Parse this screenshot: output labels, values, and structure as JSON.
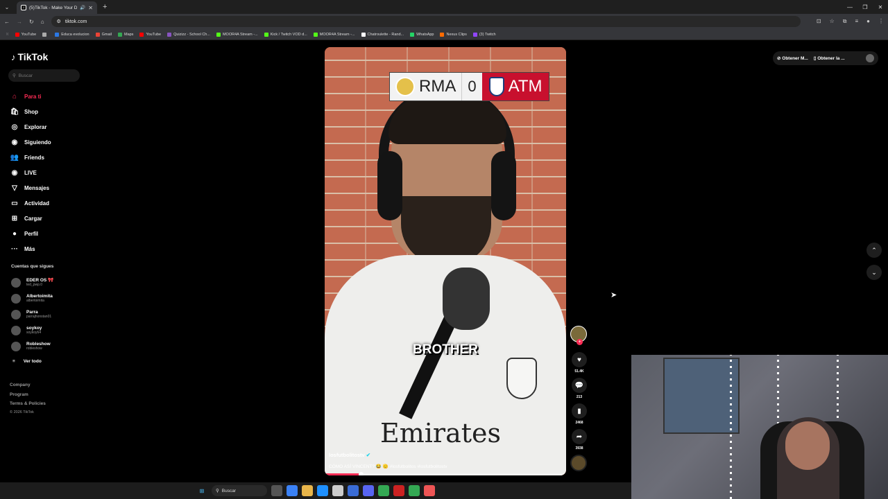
{
  "browser": {
    "tab_title": "(5)TikTok - Make Your Day",
    "url": "tiktok.com",
    "bookmarks": [
      {
        "label": "YouTube",
        "color": "#ff0000"
      },
      {
        "label": "",
        "color": "#aaaaaa"
      },
      {
        "label": "Educa evolucion",
        "color": "#2b78e4"
      },
      {
        "label": "Gmail",
        "color": "#ea4335"
      },
      {
        "label": "Maps",
        "color": "#34a853"
      },
      {
        "label": "YouTube",
        "color": "#ff0000"
      },
      {
        "label": "Quizizz - School Ch...",
        "color": "#8854c0"
      },
      {
        "label": "MOOR4A Stream -...",
        "color": "#53fc18"
      },
      {
        "label": "Kick / Twitch VOD d...",
        "color": "#53fc18"
      },
      {
        "label": "MOOR4A Stream -...",
        "color": "#53fc18"
      },
      {
        "label": "Chatroulette - Rand...",
        "color": "#ffffff"
      },
      {
        "label": "WhatsApp",
        "color": "#25d366"
      },
      {
        "label": "Nexus Clips",
        "color": "#ff6b00"
      },
      {
        "label": "(3) Twitch",
        "color": "#9146ff"
      }
    ]
  },
  "tiktok": {
    "logo": "TikTok",
    "search_placeholder": "Buscar",
    "nav": [
      {
        "label": "Para ti",
        "icon": "home-icon",
        "glyph": "⌂",
        "active": true
      },
      {
        "label": "Shop",
        "icon": "shop-icon",
        "glyph": "🛍",
        "active": false
      },
      {
        "label": "Explorar",
        "icon": "compass-icon",
        "glyph": "◎",
        "active": false
      },
      {
        "label": "Siguiendo",
        "icon": "following-icon",
        "glyph": "◉",
        "active": false
      },
      {
        "label": "Friends",
        "icon": "friends-icon",
        "glyph": "👥",
        "active": false
      },
      {
        "label": "LIVE",
        "icon": "live-icon",
        "glyph": "◉",
        "active": false
      },
      {
        "label": "Mensajes",
        "icon": "messages-icon",
        "glyph": "▽",
        "active": false
      },
      {
        "label": "Actividad",
        "icon": "activity-icon",
        "glyph": "▭",
        "active": false
      },
      {
        "label": "Cargar",
        "icon": "upload-icon",
        "glyph": "⊞",
        "active": false
      },
      {
        "label": "Perfil",
        "icon": "profile-icon",
        "glyph": "●",
        "active": false
      },
      {
        "label": "Más",
        "icon": "more-icon",
        "glyph": "···",
        "active": false
      }
    ],
    "following_header": "Cuentas que sigues",
    "following": [
      {
        "name": "EDER OS 🎀",
        "handle": "ted_pwp.0"
      },
      {
        "name": "Albertoimita",
        "handle": "albertoimita"
      },
      {
        "name": "Parra",
        "handle": "parrajhonstan01"
      },
      {
        "name": "soykoy",
        "handle": "soykoy64"
      },
      {
        "name": "Robleshow",
        "handle": "robleshow"
      }
    ],
    "see_all": "Ver todo",
    "footer": {
      "company": "Company",
      "program": "Program",
      "terms": "Terms & Policies",
      "copyright": "© 2026 TikTok"
    },
    "top_right": {
      "btn1": "Obtener M...",
      "btn2": "Obtener la ..."
    },
    "video": {
      "score_home": "RMA",
      "score_value": "0",
      "score_away": "ATM",
      "caption": "BROTHER",
      "shirt_text": "Emirates",
      "author": "losfutbolitostv",
      "description": "CÓMO ASÍ VINCENT? 😂 🫡 #losfutbolitos #losfutbolitostv",
      "progress": 0.15
    },
    "actions": {
      "likes": "51.4K",
      "comments": "213",
      "saves": "2468",
      "shares": "3938"
    }
  },
  "taskbar": {
    "search_label": "Buscar"
  }
}
